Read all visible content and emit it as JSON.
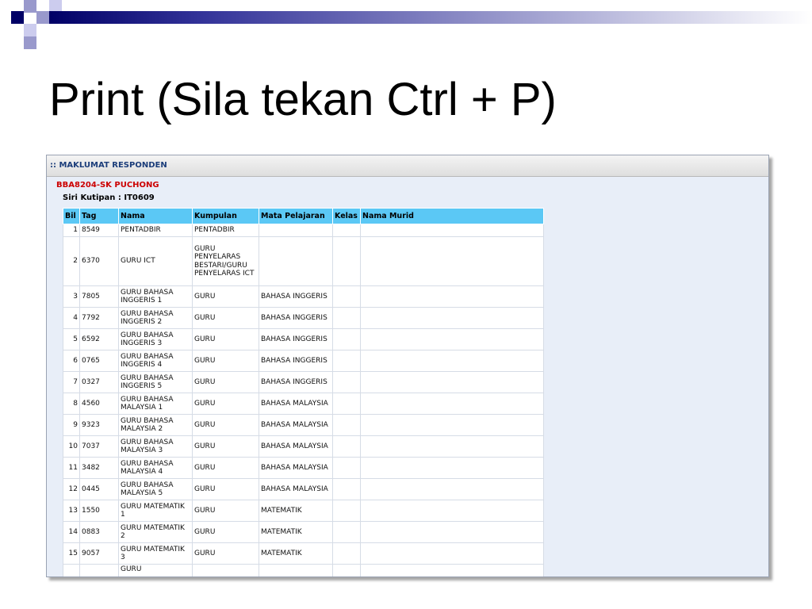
{
  "slide": {
    "title": "Print (Sila tekan Ctrl + P)"
  },
  "panel": {
    "header": ":: MAKLUMAT RESPONDEN",
    "organization": "BBA8204-SK PUCHONG",
    "siri_kutipan": "Siri Kutipan : IT0609"
  },
  "table": {
    "columns": [
      "Bil",
      "Tag",
      "Nama",
      "Kumpulan",
      "Mata Pelajaran",
      "Kelas",
      "Nama Murid"
    ],
    "rows": [
      {
        "bil": "1",
        "tag": "8549",
        "nama": "PENTADBIR",
        "kumpulan": "PENTADBIR",
        "mata_pelajaran": "",
        "kelas": "",
        "nama_murid": ""
      },
      {
        "bil": "2",
        "tag": "6370",
        "nama": "GURU ICT",
        "kumpulan": "GURU PENYELARAS BESTARI/GURU PENYELARAS ICT",
        "mata_pelajaran": "",
        "kelas": "",
        "nama_murid": ""
      },
      {
        "bil": "3",
        "tag": "7805",
        "nama": "GURU BAHASA INGGERIS 1",
        "kumpulan": "GURU",
        "mata_pelajaran": "BAHASA INGGERIS",
        "kelas": "",
        "nama_murid": ""
      },
      {
        "bil": "4",
        "tag": "7792",
        "nama": "GURU BAHASA INGGERIS 2",
        "kumpulan": "GURU",
        "mata_pelajaran": "BAHASA INGGERIS",
        "kelas": "",
        "nama_murid": ""
      },
      {
        "bil": "5",
        "tag": "6592",
        "nama": "GURU BAHASA INGGERIS 3",
        "kumpulan": "GURU",
        "mata_pelajaran": "BAHASA INGGERIS",
        "kelas": "",
        "nama_murid": ""
      },
      {
        "bil": "6",
        "tag": "0765",
        "nama": "GURU BAHASA INGGERIS 4",
        "kumpulan": "GURU",
        "mata_pelajaran": "BAHASA INGGERIS",
        "kelas": "",
        "nama_murid": ""
      },
      {
        "bil": "7",
        "tag": "0327",
        "nama": "GURU BAHASA INGGERIS 5",
        "kumpulan": "GURU",
        "mata_pelajaran": "BAHASA INGGERIS",
        "kelas": "",
        "nama_murid": ""
      },
      {
        "bil": "8",
        "tag": "4560",
        "nama": "GURU BAHASA MALAYSIA 1",
        "kumpulan": "GURU",
        "mata_pelajaran": "BAHASA MALAYSIA",
        "kelas": "",
        "nama_murid": ""
      },
      {
        "bil": "9",
        "tag": "9323",
        "nama": "GURU BAHASA MALAYSIA 2",
        "kumpulan": "GURU",
        "mata_pelajaran": "BAHASA MALAYSIA",
        "kelas": "",
        "nama_murid": ""
      },
      {
        "bil": "10",
        "tag": "7037",
        "nama": "GURU BAHASA MALAYSIA 3",
        "kumpulan": "GURU",
        "mata_pelajaran": "BAHASA MALAYSIA",
        "kelas": "",
        "nama_murid": ""
      },
      {
        "bil": "11",
        "tag": "3482",
        "nama": "GURU BAHASA MALAYSIA 4",
        "kumpulan": "GURU",
        "mata_pelajaran": "BAHASA MALAYSIA",
        "kelas": "",
        "nama_murid": ""
      },
      {
        "bil": "12",
        "tag": "0445",
        "nama": "GURU BAHASA MALAYSIA 5",
        "kumpulan": "GURU",
        "mata_pelajaran": "BAHASA MALAYSIA",
        "kelas": "",
        "nama_murid": ""
      },
      {
        "bil": "13",
        "tag": "1550",
        "nama": "GURU MATEMATIK 1",
        "kumpulan": "GURU",
        "mata_pelajaran": "MATEMATIK",
        "kelas": "",
        "nama_murid": ""
      },
      {
        "bil": "14",
        "tag": "0883",
        "nama": "GURU MATEMATIK 2",
        "kumpulan": "GURU",
        "mata_pelajaran": "MATEMATIK",
        "kelas": "",
        "nama_murid": ""
      },
      {
        "bil": "15",
        "tag": "9057",
        "nama": "GURU MATEMATIK 3",
        "kumpulan": "GURU",
        "mata_pelajaran": "MATEMATIK",
        "kelas": "",
        "nama_murid": ""
      },
      {
        "bil": "",
        "tag": "",
        "nama": "GURU",
        "kumpulan": "",
        "mata_pelajaran": "",
        "kelas": "",
        "nama_murid": ""
      }
    ]
  },
  "colors": {
    "header_accent": "#000066",
    "table_header": "#5bc8f5",
    "org_text": "#cc0000",
    "panel_body": "#e8eef8"
  }
}
